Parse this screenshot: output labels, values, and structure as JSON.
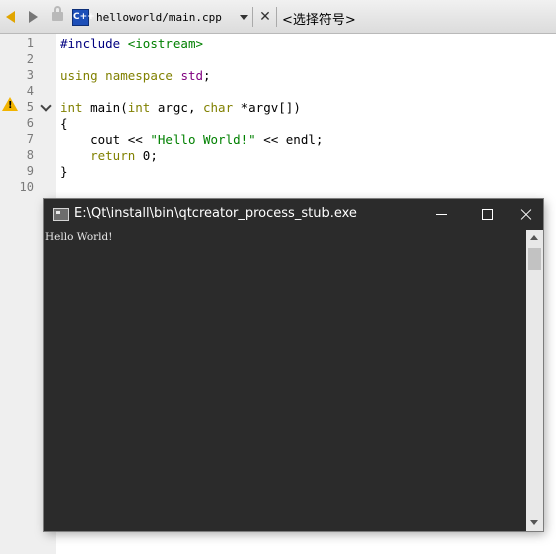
{
  "toolbar": {
    "file_type_icon_text": "C++",
    "file_name": "helloworld/main.cpp",
    "symbol_selector": "<选择符号>"
  },
  "editor": {
    "line_numbers": [
      "1",
      "2",
      "3",
      "4",
      "5",
      "6",
      "7",
      "8",
      "9",
      "10"
    ],
    "lines": {
      "l1_directive": "#include",
      "l1_header": "<iostream>",
      "l3_using": "using",
      "l3_namespace": "namespace",
      "l3_std": "std",
      "l3_semi": ";",
      "l5_int": "int",
      "l5_main": " main(",
      "l5_int2": "int",
      "l5_argc": " argc, ",
      "l5_char": "char",
      "l5_argv": " *argv[])",
      "l6": "{",
      "l7_cout": "    cout << ",
      "l7_string": "\"Hello World!\"",
      "l7_endl": " << endl;",
      "l8_return": "    return",
      "l8_zero": " 0;",
      "l9": "}"
    },
    "warning_icon": "warning-icon",
    "fold_icon": "chevron-down-icon"
  },
  "console": {
    "title": "E:\\Qt\\install\\bin\\qtcreator_process_stub.exe",
    "output": "Hello World!",
    "colors": {
      "background": "#2b2b2b",
      "text": "#e8e8e8"
    }
  }
}
